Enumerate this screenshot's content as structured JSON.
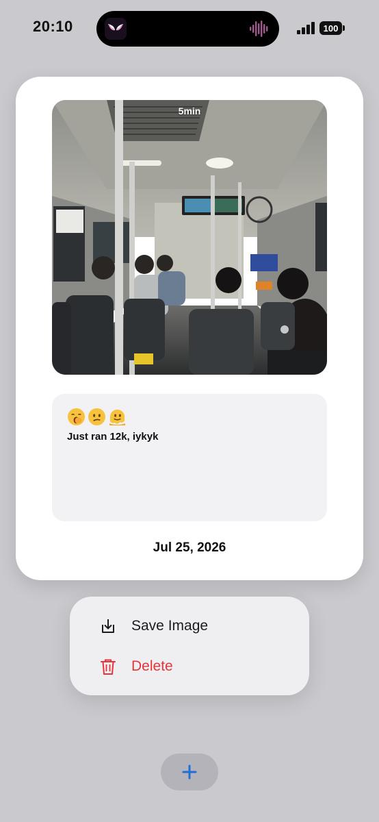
{
  "status_bar": {
    "time": "20:10",
    "battery": "100",
    "icons": [
      "spider-mask-app-icon",
      "audio-waveform-icon",
      "cellular-signal-icon",
      "battery-icon"
    ]
  },
  "card": {
    "photo_duration": "5min",
    "photo_subject": "bus-interior-photo",
    "note": {
      "emojis": [
        "yawning-face-emoji",
        "confused-face-emoji",
        "melting-face-emoji"
      ],
      "text": "Just ran 12k, iykyk"
    },
    "date": "Jul 25, 2026"
  },
  "context_menu": {
    "items": [
      {
        "label": "Save Image",
        "icon": "save-download-icon",
        "color": "#1c1c1e"
      },
      {
        "label": "Delete",
        "icon": "trash-icon",
        "color": "#e8333b"
      }
    ]
  },
  "add_button": {
    "icon": "plus-icon",
    "color": "#1f6fd6"
  },
  "colors": {
    "background": "#c9c9ce",
    "card": "#ffffff",
    "note_bg": "#f2f2f5",
    "destructive": "#e8333b",
    "accent": "#1f6fd6"
  }
}
